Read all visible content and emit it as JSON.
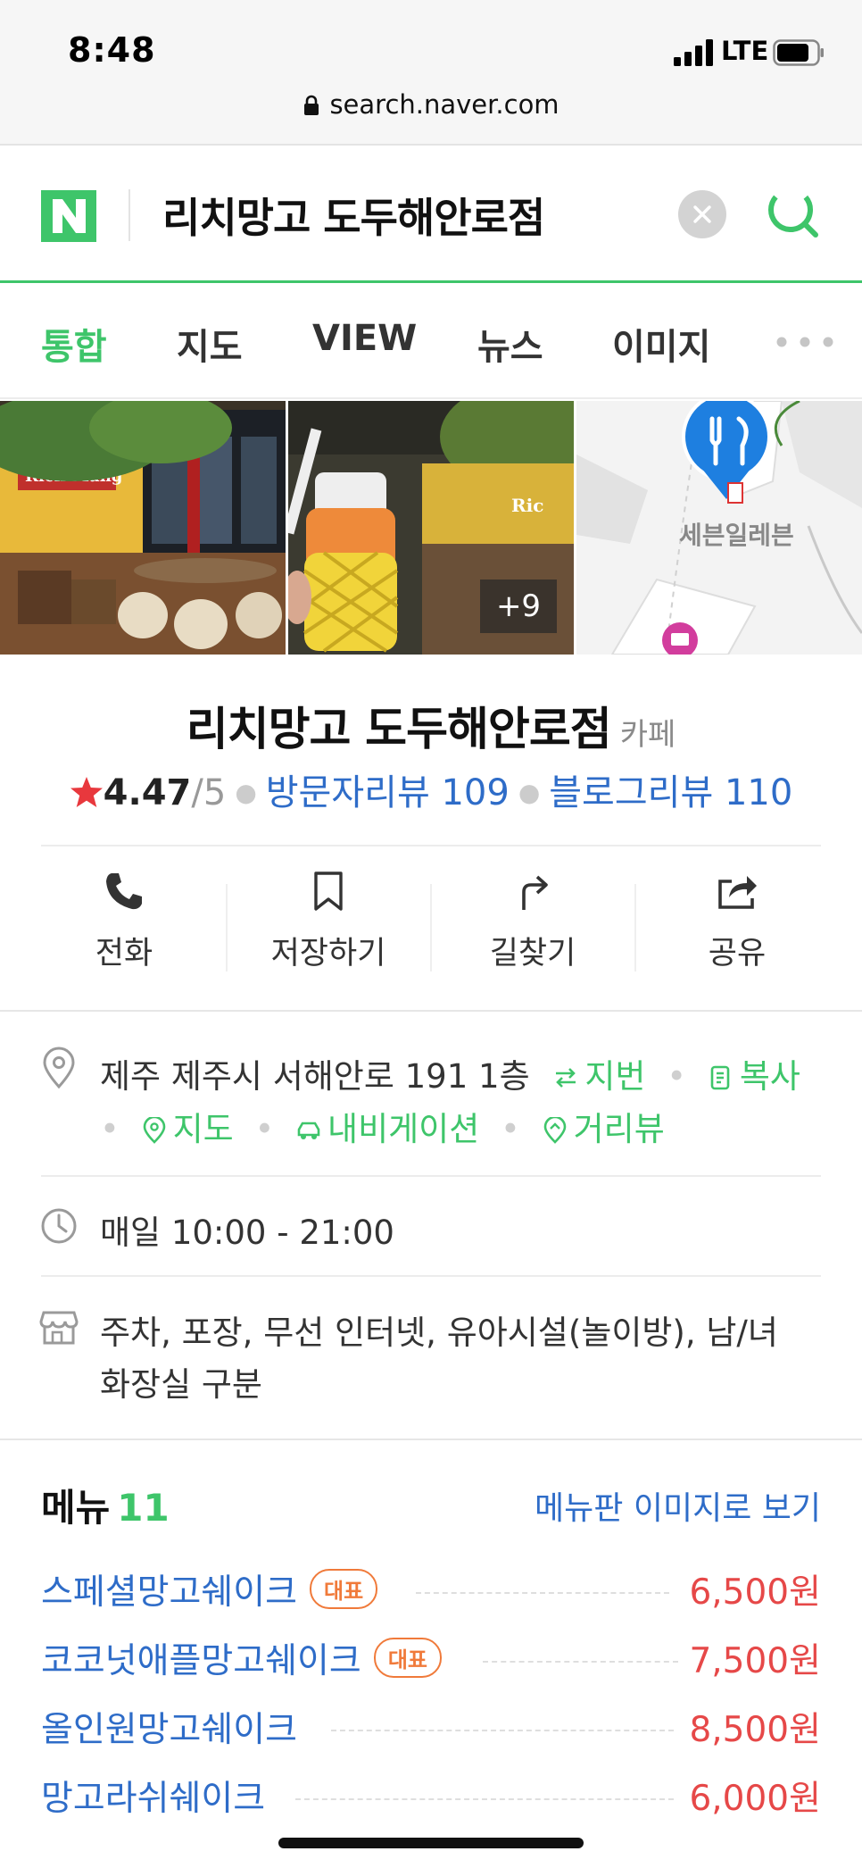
{
  "status_bar": {
    "time": "8:48",
    "network": "LTE"
  },
  "browser": {
    "url": "search.naver.com"
  },
  "search": {
    "query": "리치망고 도두해안로점",
    "logo_letter": "N"
  },
  "tabs": [
    {
      "label": "통합",
      "active": true
    },
    {
      "label": "지도",
      "active": false
    },
    {
      "label": "VIEW",
      "active": false
    },
    {
      "label": "뉴스",
      "active": false
    },
    {
      "label": "이미지",
      "active": false
    }
  ],
  "photos": {
    "more_label": "+9",
    "map_label": "세븐일레븐",
    "sign_text_1": "Rich Mang",
    "sign_text_2": "Ric"
  },
  "place": {
    "name": "리치망고 도두해안로점",
    "category": "카페",
    "rating": "4.47",
    "rating_max": "/5",
    "visitor_reviews": "방문자리뷰 109",
    "blog_reviews": "블로그리뷰 110"
  },
  "actions": [
    {
      "label": "전화",
      "icon": "phone-icon"
    },
    {
      "label": "저장하기",
      "icon": "bookmark-icon"
    },
    {
      "label": "길찾기",
      "icon": "directions-icon"
    },
    {
      "label": "공유",
      "icon": "share-icon"
    }
  ],
  "info": {
    "address": "제주 제주시 서해안로 191 1층",
    "lot_number": "지번",
    "copy": "복사",
    "map": "지도",
    "navigation": "내비게이션",
    "street_view": "거리뷰",
    "hours": "매일 10:00 - 21:00",
    "amenities_line1": "주차, 포장, 무선 인터넷, 유아시설(놀이방), 남/녀",
    "amenities_line2": "화장실 구분"
  },
  "menu": {
    "title": "메뉴",
    "count": "11",
    "image_link": "메뉴판 이미지로 보기",
    "items": [
      {
        "name": "스페셜망고쉐이크",
        "badge": "대표",
        "price": "6,500원"
      },
      {
        "name": "코코넛애플망고쉐이크",
        "badge": "대표",
        "price": "7,500원"
      },
      {
        "name": "올인원망고쉐이크",
        "badge": "",
        "price": "8,500원"
      },
      {
        "name": "망고라쉬쉐이크",
        "badge": "",
        "price": "6,000원"
      }
    ]
  },
  "colors": {
    "naver_green": "#3ec56a",
    "link_blue": "#2e6cc8",
    "price_red": "#e64848",
    "badge_orange": "#f07a3a",
    "star_red": "#e8383d"
  }
}
